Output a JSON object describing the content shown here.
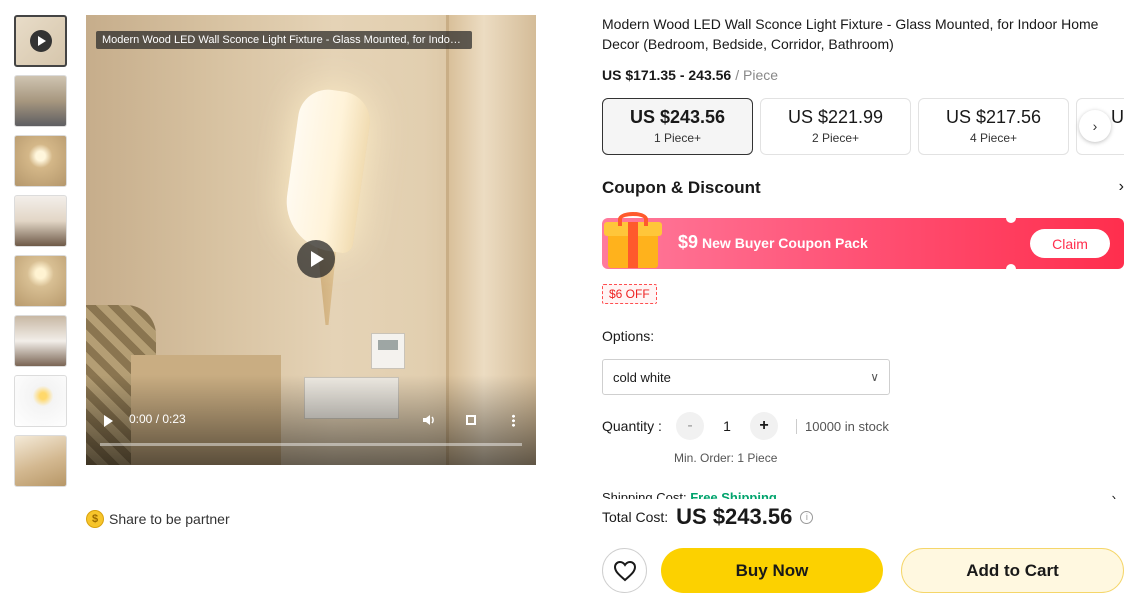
{
  "video": {
    "overlay_title": "Modern Wood LED Wall Sconce Light Fixture - Glass Mounted, for Indoor...",
    "time": "0:00 / 0:23"
  },
  "share": {
    "label": "Share to be partner"
  },
  "product": {
    "title": "Modern Wood LED Wall Sconce Light Fixture - Glass Mounted, for Indoor Home Decor (Bedroom, Bedside, Corridor, Bathroom)",
    "price_range": "US $171.35 - 243.56",
    "unit": "/ Piece"
  },
  "tiers": [
    {
      "price": "US $243.56",
      "qty": "1 Piece+"
    },
    {
      "price": "US $221.99",
      "qty": "2 Piece+"
    },
    {
      "price": "US $217.56",
      "qty": "4 Piece+"
    },
    {
      "price": "US",
      "qty": ""
    }
  ],
  "coupon": {
    "heading": "Coupon & Discount",
    "amount": "$9",
    "label": "New Buyer Coupon Pack",
    "claim": "Claim",
    "off_tag": "$6 OFF"
  },
  "options": {
    "label": "Options:",
    "selected": "cold white"
  },
  "quantity": {
    "label": "Quantity :",
    "value": "1",
    "minus": "-",
    "plus": "+",
    "stock": "10000 in stock",
    "min_order": "Min. Order: 1 Piece"
  },
  "shipping": {
    "label": "Shipping Cost:",
    "value": "Free Shipping"
  },
  "total": {
    "label": "Total Cost:",
    "value": "US $243.56"
  },
  "actions": {
    "buy_now": "Buy Now",
    "add_to_cart": "Add to Cart"
  },
  "colors": {
    "buy_now": "#fcd100",
    "coupon_accent": "#ff2e4d",
    "free_shipping": "#00a36c"
  },
  "icons": [
    "play-icon",
    "chevron-right-icon",
    "chevron-down-icon",
    "gift-icon",
    "coin-icon",
    "info-icon",
    "heart-icon",
    "volume-icon",
    "fullscreen-icon",
    "more-icon"
  ]
}
